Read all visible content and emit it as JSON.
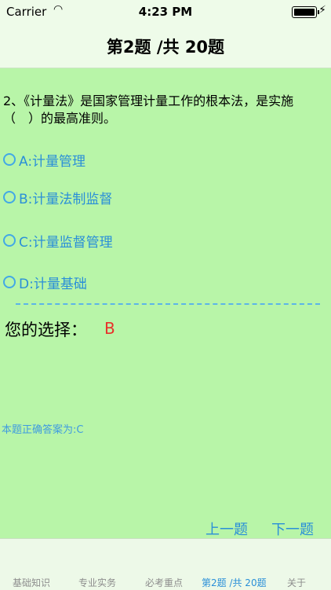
{
  "status": {
    "carrier": "Carrier",
    "time": "4:23 PM"
  },
  "nav": {
    "title": "第2题 /共 20题"
  },
  "question": {
    "text": "2、《计量法》是国家管理计量工作的根本法，是实施（　）的最高准则。"
  },
  "options": [
    {
      "label": "A:计量管理"
    },
    {
      "label": "B:计量法制监督"
    },
    {
      "label": "C:计量监督管理"
    },
    {
      "label": "D:计量基础"
    }
  ],
  "selection": {
    "label": "您的选择：",
    "value": "B"
  },
  "answer": {
    "text": "本题正确答案为:C"
  },
  "pager": {
    "prev": "上一题",
    "next": "下一题"
  },
  "tabs": [
    {
      "label": "基础知识"
    },
    {
      "label": "专业实务"
    },
    {
      "label": "必考重点"
    },
    {
      "label": "第2题 /共 20题"
    },
    {
      "label": "关于"
    }
  ],
  "colors": {
    "background": "#b8f5a8",
    "accent": "#2a8fd8",
    "selection": "#e8302a"
  }
}
